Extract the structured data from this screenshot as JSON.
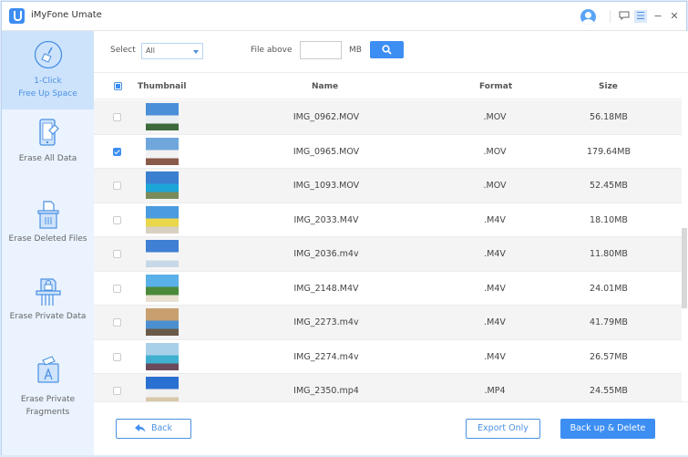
{
  "app": {
    "title": "iMyFone Umate"
  },
  "titlebar": {
    "icons": [
      "user-avatar-icon",
      "feedback-icon",
      "menu-icon",
      "minimize-icon",
      "close-icon"
    ],
    "minimize": "−",
    "close": "✕",
    "menu": "☰"
  },
  "sidebar": {
    "items": [
      {
        "label_line1": "1-Click",
        "label_line2": "Free Up Space",
        "icon": "broom-icon",
        "active": true
      },
      {
        "label_line1": "Erase All Data",
        "label_line2": "",
        "icon": "phone-eraser-icon",
        "active": false
      },
      {
        "label_line1": "Erase Deleted Files",
        "label_line2": "",
        "icon": "trash-file-icon",
        "active": false
      },
      {
        "label_line1": "Erase Private Data",
        "label_line2": "",
        "icon": "lock-shredder-icon",
        "active": false
      },
      {
        "label_line1": "Erase Private",
        "label_line2": "Fragments",
        "icon": "app-fragments-icon",
        "active": false
      }
    ]
  },
  "filter": {
    "select_label": "Select",
    "select_value": "All",
    "file_above_label": "File above",
    "size_value": "",
    "size_unit": "MB",
    "search_icon": "search-icon"
  },
  "table": {
    "headers": {
      "thumbnail": "Thumbnail",
      "name": "Name",
      "format": "Format",
      "size": "Size"
    },
    "rows": [
      {
        "name": "IMG_0962.MOV",
        "format": ".MOV",
        "size": "56.18MB",
        "checked": false,
        "thumb": [
          "#4a8fd8",
          "#e9eef2",
          "#3c6a3a"
        ]
      },
      {
        "name": "IMG_0965.MOV",
        "format": ".MOV",
        "size": "179.64MB",
        "checked": true,
        "thumb": [
          "#6fa6dc",
          "#f2f2f2",
          "#8a5a4a"
        ]
      },
      {
        "name": "IMG_1093.MOV",
        "format": ".MOV",
        "size": "52.45MB",
        "checked": false,
        "thumb": [
          "#3a7fd0",
          "#1ca6d8",
          "#7a8a5a"
        ]
      },
      {
        "name": "IMG_2033.M4V",
        "format": ".M4V",
        "size": "18.10MB",
        "checked": false,
        "thumb": [
          "#4a9be0",
          "#e8d84a",
          "#d8d0c0"
        ]
      },
      {
        "name": "IMG_2036.m4v",
        "format": ".M4V",
        "size": "11.80MB",
        "checked": false,
        "thumb": [
          "#3f7fd4",
          "#f5f5f5",
          "#c8d8e8"
        ]
      },
      {
        "name": "IMG_2148.M4V",
        "format": ".M4V",
        "size": "24.01MB",
        "checked": false,
        "thumb": [
          "#5ab0e8",
          "#4a8a3a",
          "#e8e0d0"
        ]
      },
      {
        "name": "IMG_2273.m4v",
        "format": ".M4V",
        "size": "41.79MB",
        "checked": false,
        "thumb": [
          "#c8a070",
          "#4a90d0",
          "#6a5a4a"
        ]
      },
      {
        "name": "IMG_2274.m4v",
        "format": ".M4V",
        "size": "26.57MB",
        "checked": false,
        "thumb": [
          "#a8d0e8",
          "#3fb0d0",
          "#6a4a5a"
        ]
      },
      {
        "name": "IMG_2350.mp4",
        "format": ".MP4",
        "size": "24.55MB",
        "checked": false,
        "thumb": [
          "#2a70d0",
          "#f0f0f0",
          "#d8c8a8"
        ]
      }
    ]
  },
  "footer": {
    "back_label": "Back",
    "export_label": "Export Only",
    "delete_label": "Back up & Delete"
  },
  "colors": {
    "accent": "#3d8ef2",
    "sidebar_bg": "#eaf3fe",
    "sidebar_active": "#cde3fc"
  }
}
